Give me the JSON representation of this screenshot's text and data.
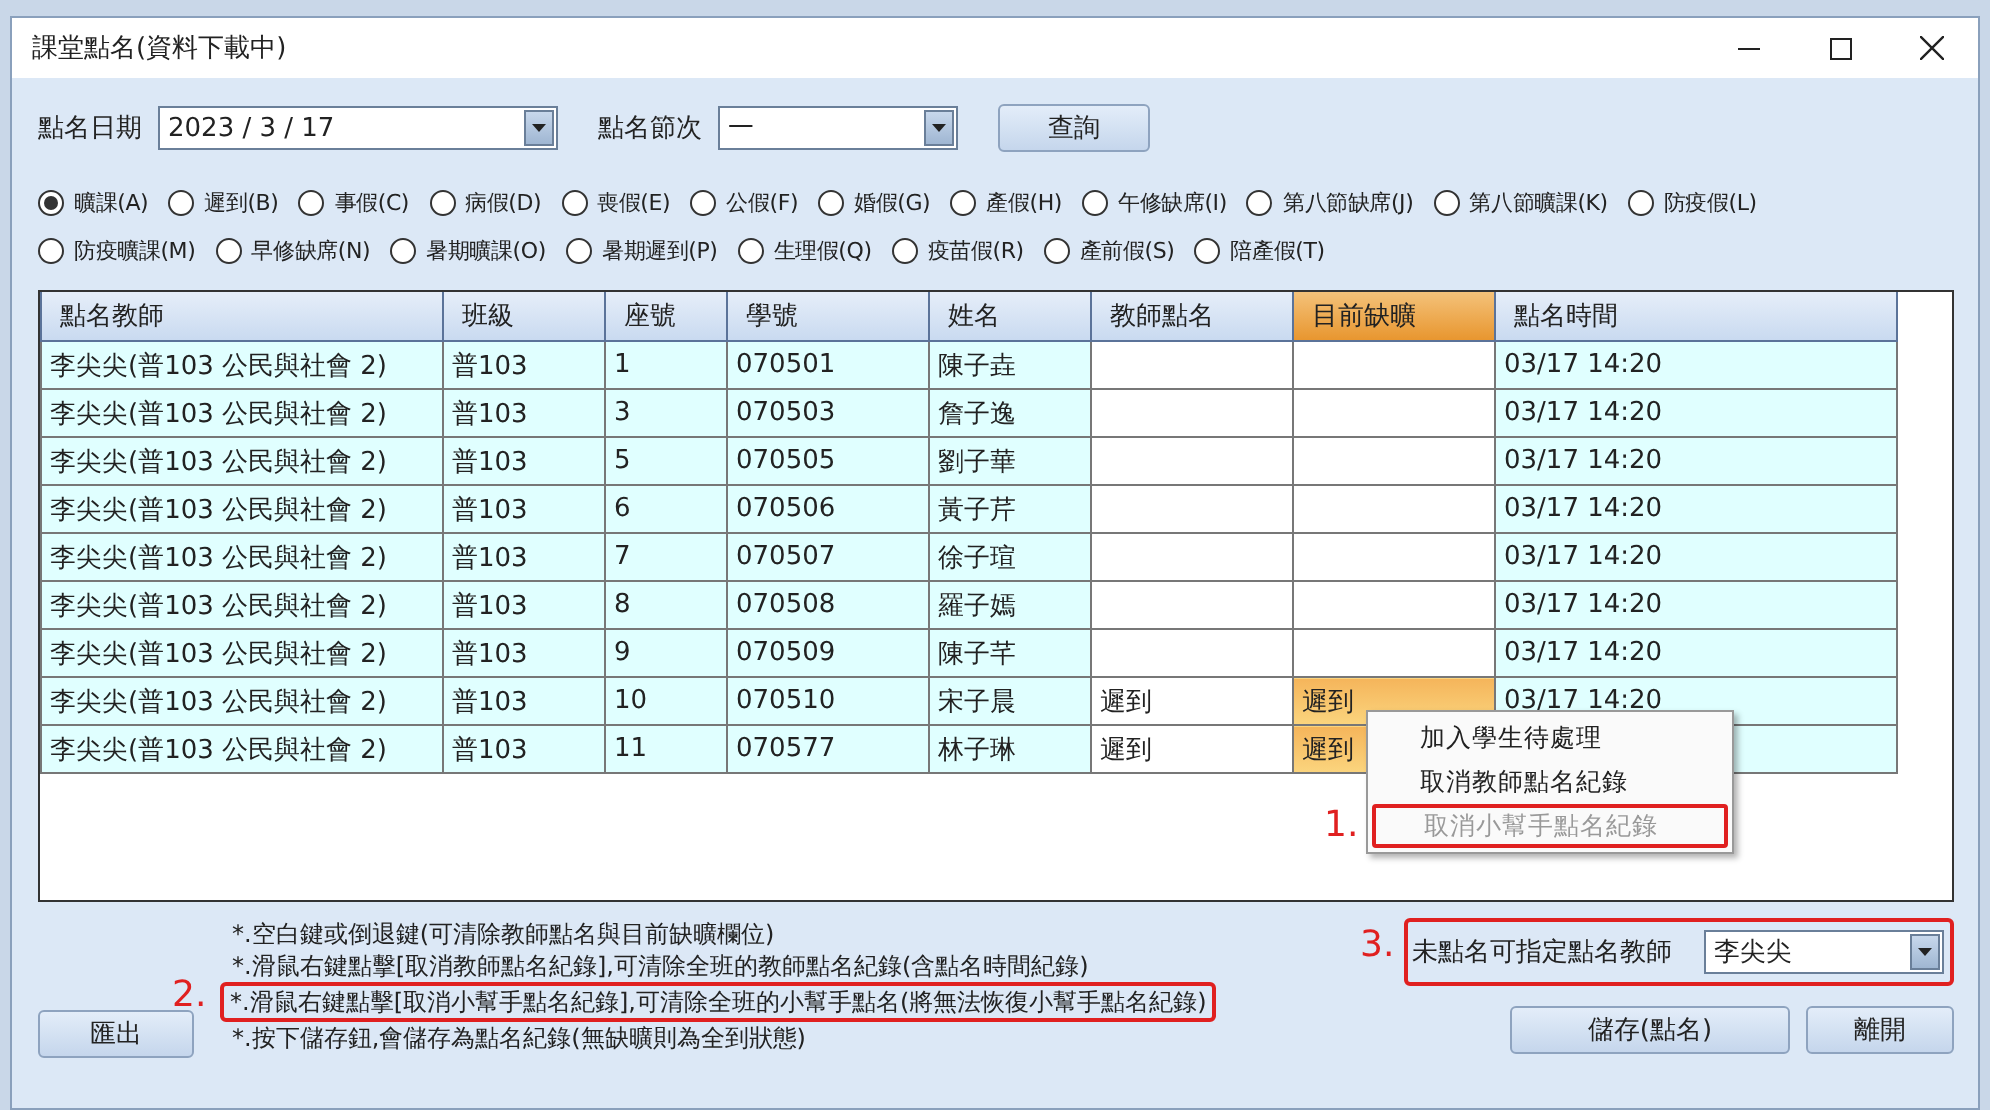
{
  "window": {
    "title": "課堂點名(資料下載中)"
  },
  "filters": {
    "date_label": "點名日期",
    "date_value": "2023 / 3 / 17",
    "period_label": "點名節次",
    "period_value": "一",
    "query_button": "查詢"
  },
  "absence_types": [
    [
      {
        "label": "曠課(A)",
        "selected": true
      },
      {
        "label": "遲到(B)",
        "selected": false
      },
      {
        "label": "事假(C)",
        "selected": false
      },
      {
        "label": "病假(D)",
        "selected": false
      },
      {
        "label": "喪假(E)",
        "selected": false
      },
      {
        "label": "公假(F)",
        "selected": false
      },
      {
        "label": "婚假(G)",
        "selected": false
      },
      {
        "label": "產假(H)",
        "selected": false
      },
      {
        "label": "午修缺席(I)",
        "selected": false
      },
      {
        "label": "第八節缺席(J)",
        "selected": false
      },
      {
        "label": "第八節曠課(K)",
        "selected": false
      },
      {
        "label": "防疫假(L)",
        "selected": false
      }
    ],
    [
      {
        "label": "防疫曠課(M)",
        "selected": false
      },
      {
        "label": "早修缺席(N)",
        "selected": false
      },
      {
        "label": "暑期曠課(O)",
        "selected": false
      },
      {
        "label": "暑期遲到(P)",
        "selected": false
      },
      {
        "label": "生理假(Q)",
        "selected": false
      },
      {
        "label": "疫苗假(R)",
        "selected": false
      },
      {
        "label": "產前假(S)",
        "selected": false
      },
      {
        "label": "陪產假(T)",
        "selected": false
      }
    ]
  ],
  "table": {
    "columns": [
      {
        "label": "點名教師",
        "kind": "data",
        "selected": false
      },
      {
        "label": "班級",
        "kind": "data",
        "selected": false
      },
      {
        "label": "座號",
        "kind": "data",
        "selected": false
      },
      {
        "label": "學號",
        "kind": "data",
        "selected": false
      },
      {
        "label": "姓名",
        "kind": "data",
        "selected": false
      },
      {
        "label": "教師點名",
        "kind": "input",
        "selected": false
      },
      {
        "label": "目前缺曠",
        "kind": "input",
        "selected": true
      },
      {
        "label": "點名時間",
        "kind": "data",
        "selected": false
      }
    ],
    "rows": [
      {
        "cells": [
          "李尖尖(普103 公民與社會 2)",
          "普103",
          "1",
          "070501",
          "陳子垚",
          "",
          "",
          "03/17 14:20"
        ],
        "selected": false
      },
      {
        "cells": [
          "李尖尖(普103 公民與社會 2)",
          "普103",
          "3",
          "070503",
          "詹子逸",
          "",
          "",
          "03/17 14:20"
        ],
        "selected": false
      },
      {
        "cells": [
          "李尖尖(普103 公民與社會 2)",
          "普103",
          "5",
          "070505",
          "劉子華",
          "",
          "",
          "03/17 14:20"
        ],
        "selected": false
      },
      {
        "cells": [
          "李尖尖(普103 公民與社會 2)",
          "普103",
          "6",
          "070506",
          "黃子芹",
          "",
          "",
          "03/17 14:20"
        ],
        "selected": false
      },
      {
        "cells": [
          "李尖尖(普103 公民與社會 2)",
          "普103",
          "7",
          "070507",
          "徐子瑄",
          "",
          "",
          "03/17 14:20"
        ],
        "selected": false
      },
      {
        "cells": [
          "李尖尖(普103 公民與社會 2)",
          "普103",
          "8",
          "070508",
          "羅子嫣",
          "",
          "",
          "03/17 14:20"
        ],
        "selected": false
      },
      {
        "cells": [
          "李尖尖(普103 公民與社會 2)",
          "普103",
          "9",
          "070509",
          "陳子芊",
          "",
          "",
          "03/17 14:20"
        ],
        "selected": false
      },
      {
        "cells": [
          "李尖尖(普103 公民與社會 2)",
          "普103",
          "10",
          "070510",
          "宋子晨",
          "遲到",
          "遲到",
          "03/17 14:20"
        ],
        "selected": true
      },
      {
        "cells": [
          "李尖尖(普103 公民與社會 2)",
          "普103",
          "11",
          "070577",
          "林子琳",
          "遲到",
          "遲到",
          ""
        ],
        "selected": true
      }
    ]
  },
  "context_menu": [
    {
      "label": "加入學生待處理",
      "disabled": false
    },
    {
      "label": "取消教師點名紀錄",
      "disabled": false
    },
    {
      "label": "取消小幫手點名紀錄",
      "disabled": true,
      "annotation": "1."
    }
  ],
  "export_button": "匯出",
  "notes": [
    {
      "text": "*.空白鍵或倒退鍵(可清除教師點名與目前缺曠欄位)"
    },
    {
      "text": "*.滑鼠右鍵點擊[取消教師點名紀錄],可清除全班的教師點名紀錄(含點名時間紀錄)"
    },
    {
      "text": "*.滑鼠右鍵點擊[取消小幫手點名紀錄],可清除全班的小幫手點名(將無法恢復小幫手點名紀錄)",
      "annotation": "2."
    },
    {
      "text": "*.按下儲存鈕,會儲存為點名紀錄(無缺曠則為全到狀態)"
    }
  ],
  "teacher_picker": {
    "label": "未點名可指定點名教師",
    "value": "李尖尖",
    "annotation": "3."
  },
  "buttons": [
    "儲存(點名)",
    "離開"
  ]
}
